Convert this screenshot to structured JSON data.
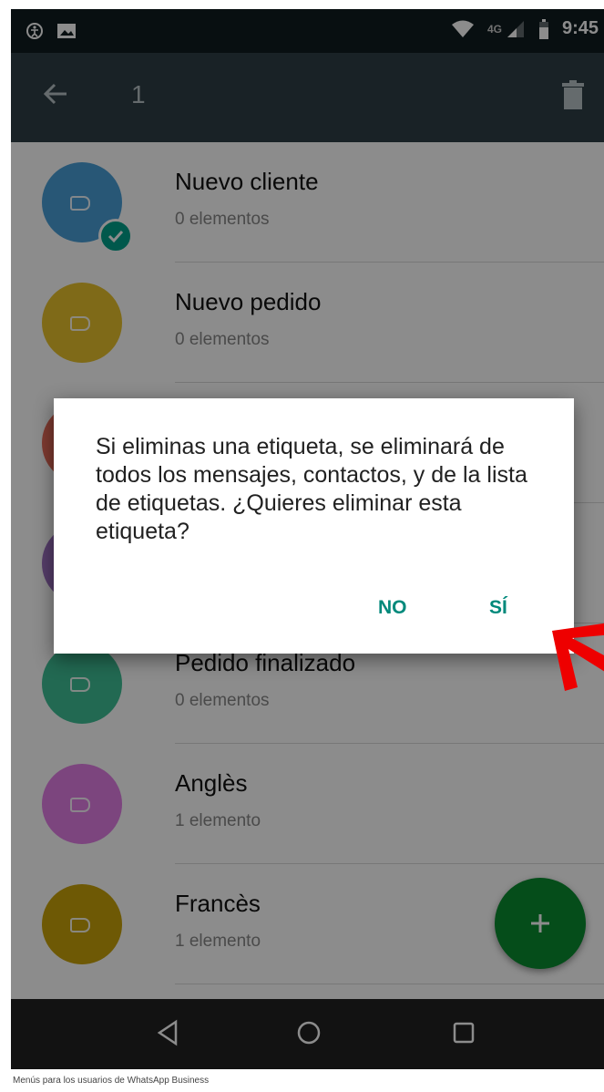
{
  "status_bar": {
    "network": "4G",
    "time": "9:45"
  },
  "app_bar": {
    "selected_count": "1"
  },
  "labels": [
    {
      "name": "Nuevo cliente",
      "count": "0 elementos",
      "color": "#4a9fd8",
      "selected": true
    },
    {
      "name": "Nuevo pedido",
      "count": "0 elementos",
      "color": "#e8c12c"
    },
    {
      "name": "",
      "count": "",
      "color": "#e56b58"
    },
    {
      "name": "",
      "count": "",
      "color": "#9c6fc0"
    },
    {
      "name": "Pedido finalizado",
      "count": "0 elementos",
      "color": "#3fbf95"
    },
    {
      "name": "Anglès",
      "count": "1 elemento",
      "color": "#e27fe6"
    },
    {
      "name": "Francès",
      "count": "1 elemento",
      "color": "#c9a20a"
    }
  ],
  "dialog": {
    "message": "Si eliminas una etiqueta, se eliminará de todos los mensajes, contactos, y de la lista de etiquetas. ¿Quieres eliminar esta etiqueta?",
    "no_label": "NO",
    "yes_label": "SÍ"
  },
  "annotation_color": "#ee0000",
  "accent_color": "#00897b",
  "fab_color": "#0a8c30",
  "caption": "Menús para los usuarios de WhatsApp Business"
}
